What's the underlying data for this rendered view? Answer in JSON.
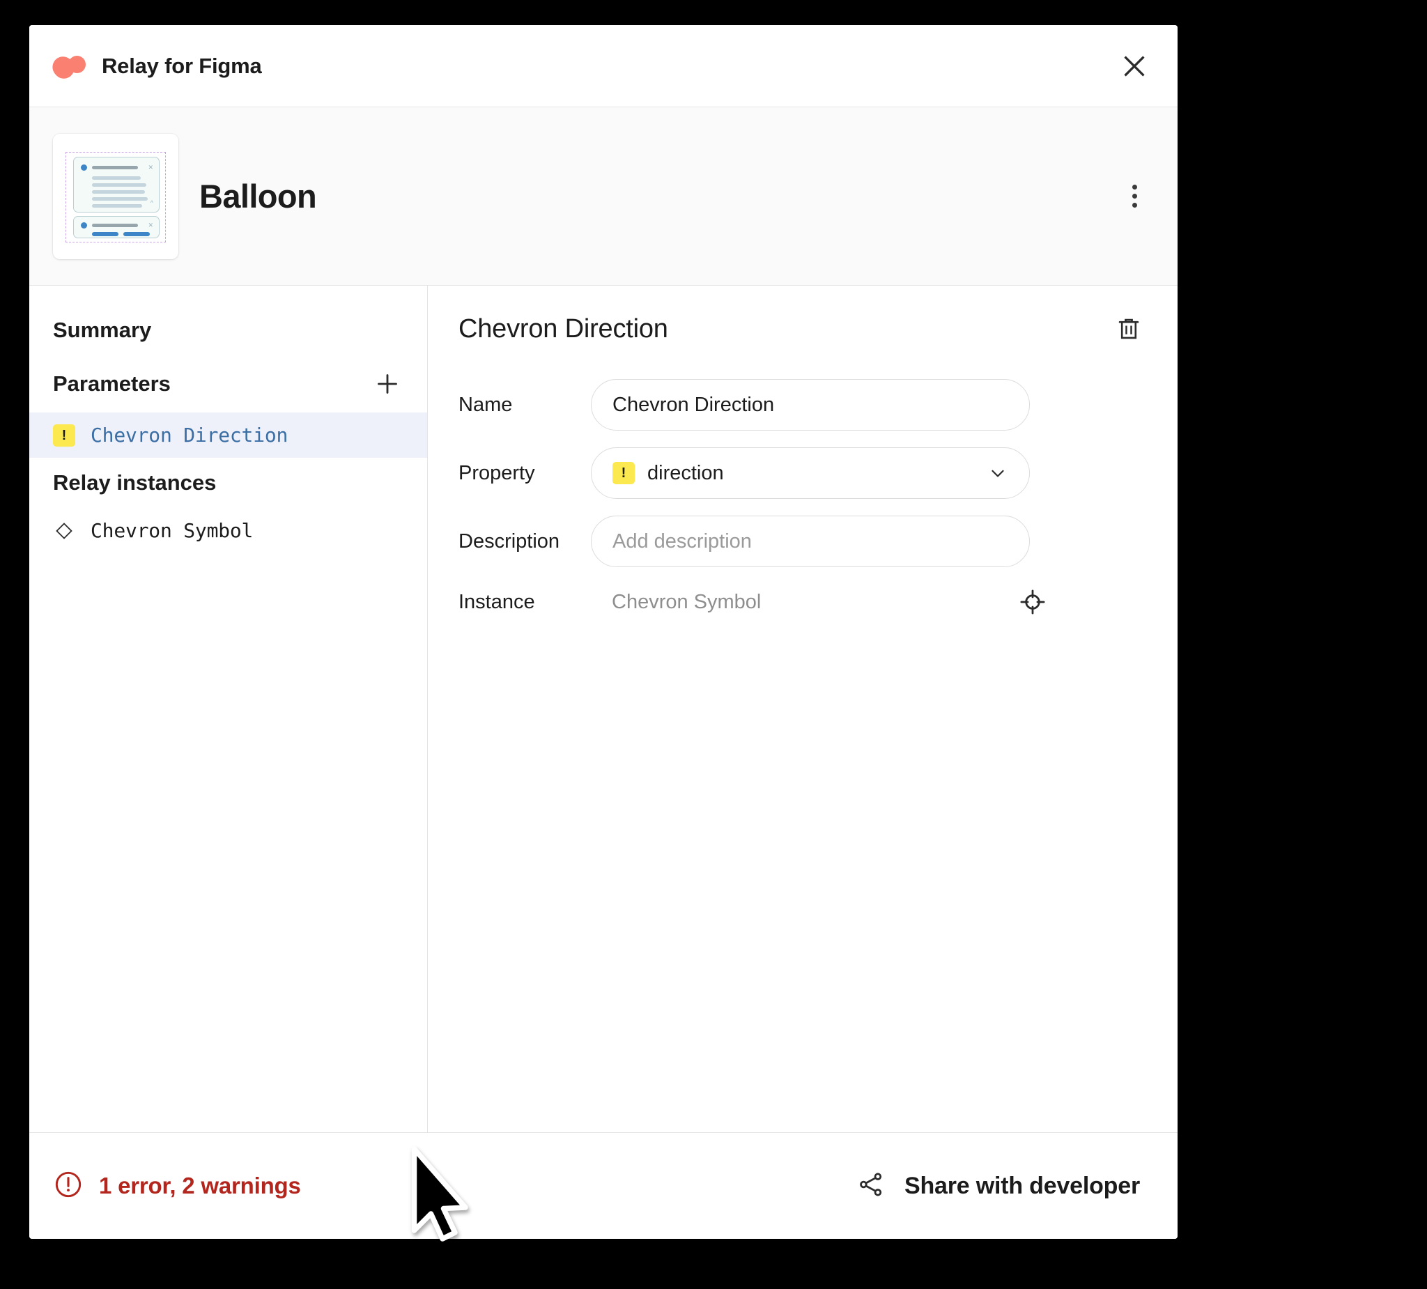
{
  "titlebar": {
    "app_title": "Relay for Figma",
    "logo_color": "#FA8072",
    "close_icon": "close-icon"
  },
  "file_header": {
    "file_name": "Balloon",
    "thumbnail_alt": "balloon-frame-thumbnail",
    "menu_icon": "kebab-menu-icon"
  },
  "sidebar": {
    "summary_label": "Summary",
    "parameters_label": "Parameters",
    "add_parameter_icon": "plus-icon",
    "parameters": [
      {
        "label": "Chevron Direction",
        "badge": "!",
        "badge_color": "#FCE94F",
        "selected": true,
        "selected_bg": "#EEF1FA",
        "text_color": "#3A6EA5"
      }
    ],
    "relay_instances_label": "Relay instances",
    "instances": [
      {
        "label": "Chevron Symbol",
        "icon": "diamond-icon"
      }
    ]
  },
  "detail": {
    "title": "Chevron Direction",
    "delete_icon": "trash-icon",
    "rows": {
      "name": {
        "label": "Name",
        "value": "Chevron Direction"
      },
      "property": {
        "label": "Property",
        "value": "direction",
        "badge": "!",
        "badge_color": "#FCE94F",
        "chevron_icon": "chevron-down-icon"
      },
      "description": {
        "label": "Description",
        "value": "",
        "placeholder": "Add description"
      },
      "instance": {
        "label": "Instance",
        "value": "Chevron Symbol",
        "locate_icon": "target-icon"
      }
    }
  },
  "footer": {
    "status_text": "1 error, 2 warnings",
    "status_color": "#B3261E",
    "status_icon": "error-circle-icon",
    "share_label": "Share with developer",
    "share_icon": "share-icon"
  }
}
